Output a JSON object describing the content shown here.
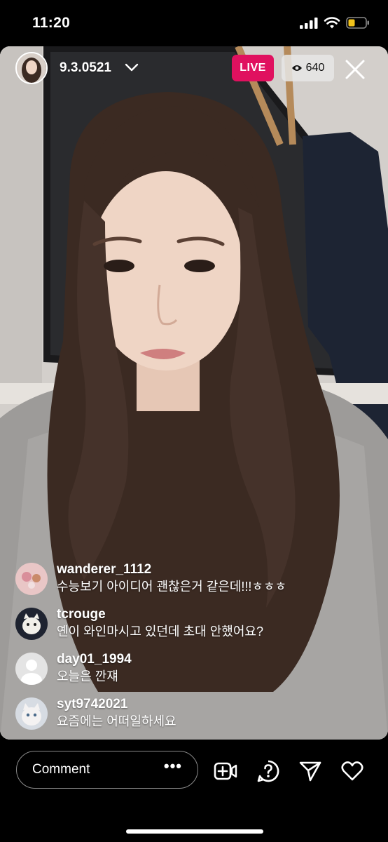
{
  "status_bar": {
    "time": "11:20"
  },
  "header": {
    "username": "9.3.0521",
    "live_label": "LIVE",
    "viewer_count": "640"
  },
  "comments": [
    {
      "username": "wanderer_1112",
      "text": "수능보기 아이디어 괜찮은거 같은데!!!ㅎㅎㅎ"
    },
    {
      "username": "tcrouge",
      "text": "옌이 와인마시고 있던데 초대 안했어요?"
    },
    {
      "username": "day01_1994",
      "text": "오늘은 깐쟤"
    },
    {
      "username": "syt9742021",
      "text": "요즘에는 어떠일하세요"
    }
  ],
  "bottom_bar": {
    "comment_placeholder": "Comment",
    "more_label": "•••"
  },
  "colors": {
    "live_badge": "#e0115f",
    "background": "#000000"
  },
  "icons": {
    "add_video": "add-video-icon",
    "question": "question-icon",
    "share": "send-icon",
    "like": "heart-icon"
  }
}
